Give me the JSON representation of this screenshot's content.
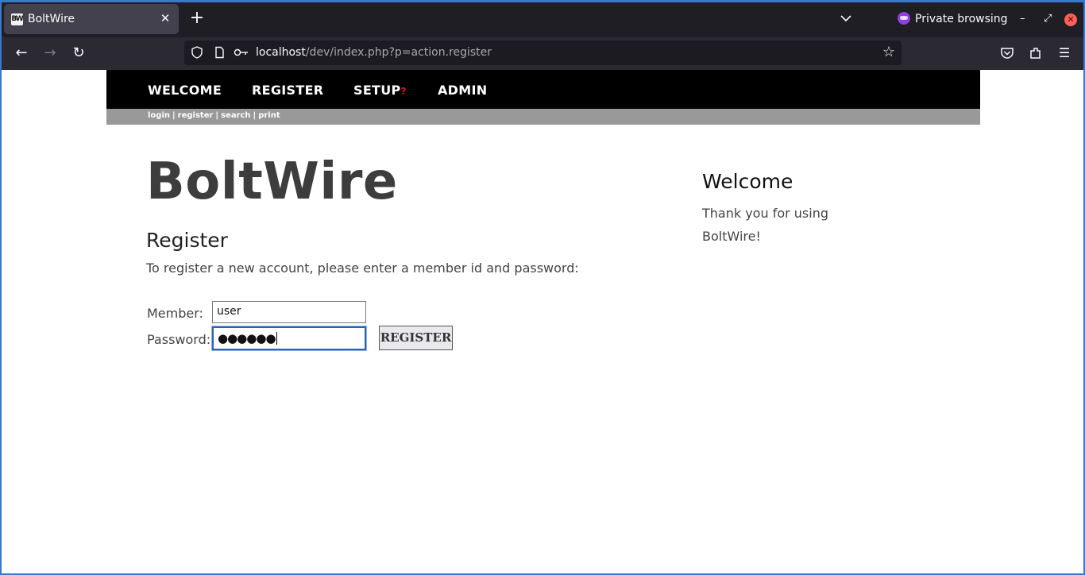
{
  "browser": {
    "tab_title": "BoltWire",
    "favicon_text": "BW",
    "tab_close": "✕",
    "new_tab": "+",
    "private_label": "Private browsing",
    "url_host": "localhost",
    "url_path": "/dev/index.php?p=action.register"
  },
  "menu": {
    "welcome": "WELCOME",
    "register": "REGISTER",
    "setup": "SETUP",
    "setup_mark": "?",
    "admin": "ADMIN"
  },
  "submenu": {
    "login": "login",
    "register": "register",
    "search": "search",
    "print": "print",
    "separator": "|"
  },
  "main": {
    "site_title": "BoltWire",
    "heading": "Register",
    "intro": "To register a new account, please enter a member id and password:",
    "member_label": "Member:",
    "member_value": "user",
    "password_label": "Password:",
    "password_masked": "●●●●●●",
    "register_button": "REGISTER"
  },
  "sidebar": {
    "title": "Welcome",
    "text": "Thank you for using BoltWire!"
  }
}
